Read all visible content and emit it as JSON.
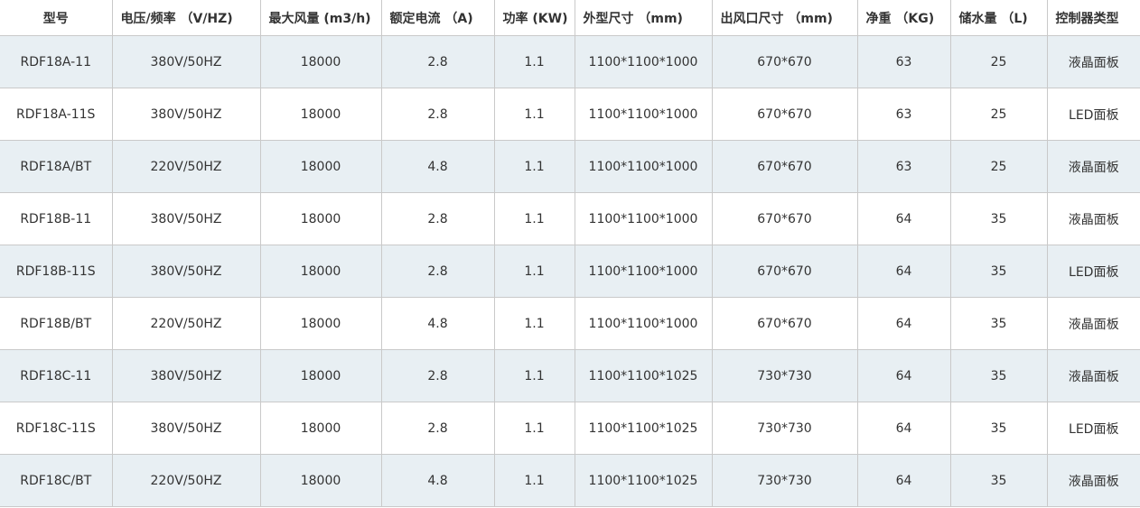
{
  "table": {
    "headers": [
      "型号",
      "电压/频率 （V/HZ)",
      "最大风量 (m3/h)",
      "额定电流 （A)",
      "功率 (KW)",
      "外型尺寸 （mm)",
      "出风口尺寸 （mm)",
      "净重 （KG)",
      "储水量 （L)",
      "控制器类型"
    ],
    "rows": [
      [
        "RDF18A-11",
        "380V/50HZ",
        "18000",
        "2.8",
        "1.1",
        "1100*1100*1000",
        "670*670",
        "63",
        "25",
        "液晶面板"
      ],
      [
        "RDF18A-11S",
        "380V/50HZ",
        "18000",
        "2.8",
        "1.1",
        "1100*1100*1000",
        "670*670",
        "63",
        "25",
        "LED面板"
      ],
      [
        "RDF18A/BT",
        "220V/50HZ",
        "18000",
        "4.8",
        "1.1",
        "1100*1100*1000",
        "670*670",
        "63",
        "25",
        "液晶面板"
      ],
      [
        "RDF18B-11",
        "380V/50HZ",
        "18000",
        "2.8",
        "1.1",
        "1100*1100*1000",
        "670*670",
        "64",
        "35",
        "液晶面板"
      ],
      [
        "RDF18B-11S",
        "380V/50HZ",
        "18000",
        "2.8",
        "1.1",
        "1100*1100*1000",
        "670*670",
        "64",
        "35",
        "LED面板"
      ],
      [
        "RDF18B/BT",
        "220V/50HZ",
        "18000",
        "4.8",
        "1.1",
        "1100*1100*1000",
        "670*670",
        "64",
        "35",
        "液晶面板"
      ],
      [
        "RDF18C-11",
        "380V/50HZ",
        "18000",
        "2.8",
        "1.1",
        "1100*1100*1025",
        "730*730",
        "64",
        "35",
        "液晶面板"
      ],
      [
        "RDF18C-11S",
        "380V/50HZ",
        "18000",
        "2.8",
        "1.1",
        "1100*1100*1025",
        "730*730",
        "64",
        "35",
        "LED面板"
      ],
      [
        "RDF18C/BT",
        "220V/50HZ",
        "18000",
        "4.8",
        "1.1",
        "1100*1100*1025",
        "730*730",
        "64",
        "35",
        "液晶面板"
      ]
    ]
  },
  "colors": {
    "shaded_row": "#e8eff3",
    "plain_row": "#ffffff",
    "border": "#c9c9c9",
    "text": "#333333"
  }
}
